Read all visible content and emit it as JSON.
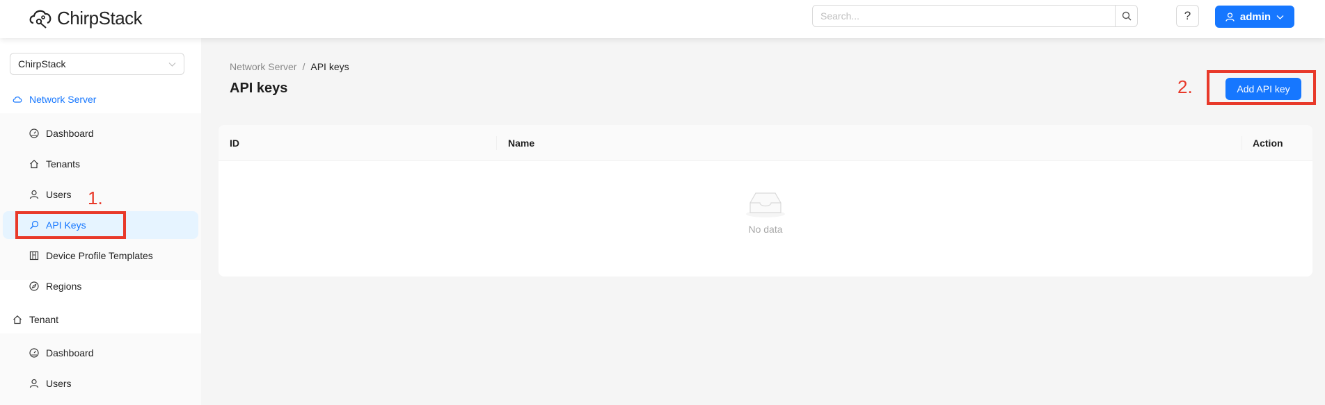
{
  "app": {
    "name": "ChirpStack"
  },
  "header": {
    "search_placeholder": "Search...",
    "help_label": "?",
    "user_label": "admin"
  },
  "sidebar": {
    "tenant_select": "ChirpStack",
    "network_server": {
      "label": "Network Server",
      "items": [
        {
          "label": "Dashboard",
          "icon": "dashboard-icon"
        },
        {
          "label": "Tenants",
          "icon": "home-icon"
        },
        {
          "label": "Users",
          "icon": "user-icon"
        },
        {
          "label": "API Keys",
          "icon": "key-icon",
          "selected": true
        },
        {
          "label": "Device Profile Templates",
          "icon": "template-icon"
        },
        {
          "label": "Regions",
          "icon": "compass-icon"
        }
      ]
    },
    "tenant": {
      "label": "Tenant",
      "items": [
        {
          "label": "Dashboard",
          "icon": "dashboard-icon"
        },
        {
          "label": "Users",
          "icon": "user-icon"
        }
      ]
    }
  },
  "main": {
    "breadcrumb": [
      "Network Server",
      "API keys"
    ],
    "breadcrumb_sep": "/",
    "title": "API keys",
    "add_button": "Add API key",
    "table": {
      "columns": [
        "ID",
        "Name",
        "Action"
      ],
      "empty_text": "No data"
    }
  },
  "annotations": {
    "step1": "1.",
    "step2": "2.",
    "color": "#e8392a"
  },
  "colors": {
    "primary": "#1677ff",
    "selected_bg": "#e6f4ff"
  }
}
